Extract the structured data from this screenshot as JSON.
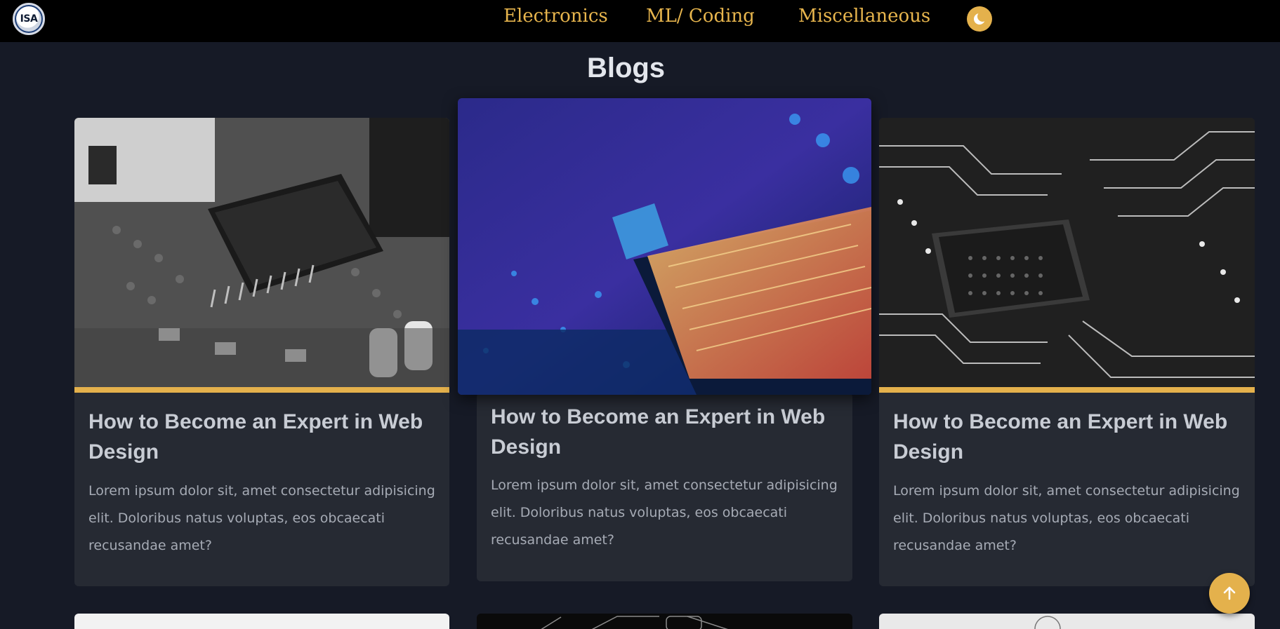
{
  "navbar": {
    "logo_text": "ISA",
    "links": [
      "Electronics",
      "ML/ Coding",
      "Miscellaneous"
    ],
    "theme_toggle_icon": "moon-icon"
  },
  "page": {
    "title": "Blogs"
  },
  "cards": [
    {
      "title": "How to Become an Expert in Web Design",
      "text": "Lorem ipsum dolor sit, amet consectetur adipisicing elit. Doloribus natus voluptas, eos obcaecati recusandae amet?",
      "image": "grayscale-circuit-board-chip"
    },
    {
      "title": "How to Become an Expert in Web Design",
      "text": "Lorem ipsum dolor sit, amet consectetur adipisicing elit. Doloribus natus voluptas, eos obcaecati recusandae amet?",
      "image": "blue-cpu-pins"
    },
    {
      "title": "How to Become an Expert in Web Design",
      "text": "Lorem ipsum dolor sit, amet consectetur adipisicing elit. Doloribus natus voluptas, eos obcaecati recusandae amet?",
      "image": "grayscale-cpu-traces"
    }
  ],
  "scroll_top": {
    "icon": "arrow-up-icon"
  },
  "colors": {
    "accent": "#e4b14c",
    "background": "#161a26",
    "card": "#262a33",
    "navbar": "#000000"
  }
}
